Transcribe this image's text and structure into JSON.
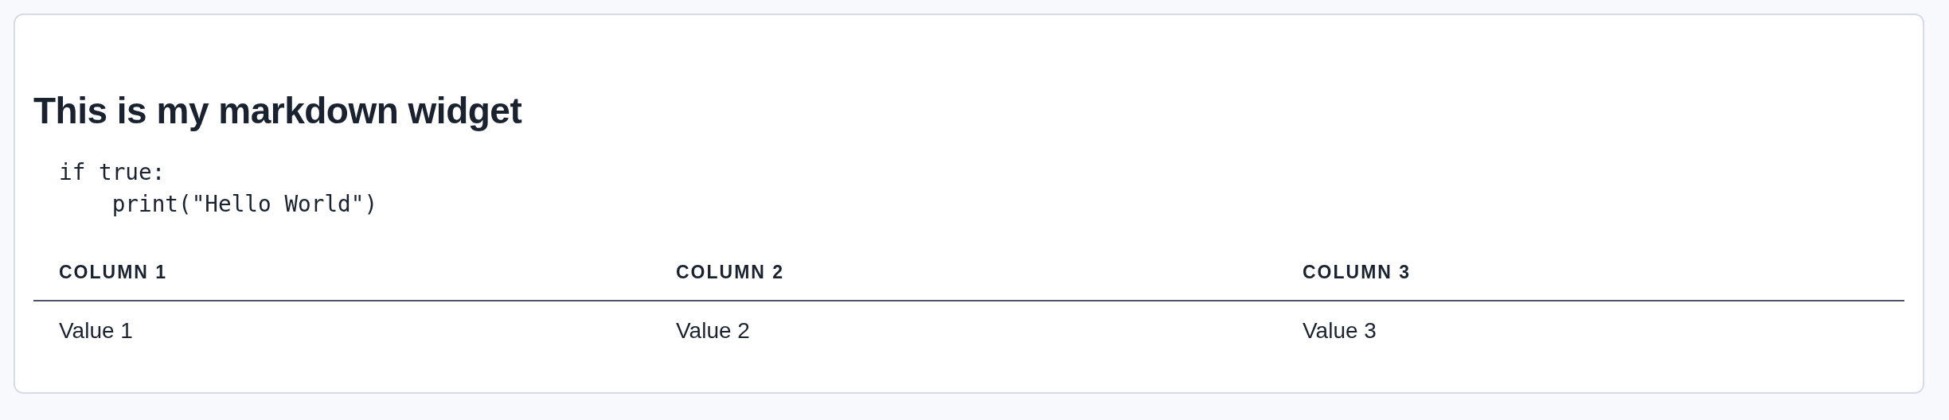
{
  "widget": {
    "heading": "This is my markdown widget",
    "code_lines": [
      "if true:",
      "    print(\"Hello World\")"
    ],
    "table": {
      "columns": [
        "COLUMN 1",
        "COLUMN 2",
        "COLUMN 3"
      ],
      "rows": [
        [
          "Value 1",
          "Value 2",
          "Value 3"
        ]
      ]
    }
  }
}
